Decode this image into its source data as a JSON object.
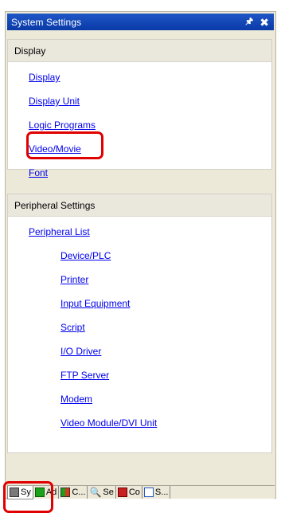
{
  "window": {
    "title": "System Settings"
  },
  "display_section": {
    "header": "Display",
    "items": [
      {
        "label": "Display"
      },
      {
        "label": "Display Unit"
      },
      {
        "label": "Logic Programs"
      },
      {
        "label": "Video/Movie"
      },
      {
        "label": "Font"
      }
    ]
  },
  "peripheral_section": {
    "header": "Peripheral Settings",
    "top_item": {
      "label": "Peripheral List"
    },
    "items": [
      {
        "label": "Device/PLC"
      },
      {
        "label": "Printer"
      },
      {
        "label": "Input Equipment"
      },
      {
        "label": "Script"
      },
      {
        "label": "I/O Driver"
      },
      {
        "label": "FTP Server"
      },
      {
        "label": "Modem"
      },
      {
        "label": "Video Module/DVI Unit"
      }
    ]
  },
  "tabs": [
    {
      "label": "Sy",
      "icon": "system-settings-icon"
    },
    {
      "label": "Ad",
      "icon": "address-icon"
    },
    {
      "label": "C...",
      "icon": "common-icon"
    },
    {
      "label": "Se",
      "icon": "search-icon"
    },
    {
      "label": "Co",
      "icon": "comment-icon"
    },
    {
      "label": "S...",
      "icon": "screen-icon"
    }
  ],
  "colors": {
    "title_bar": "#0a3aa8",
    "link": "#0000ee",
    "highlight": "#e00000"
  }
}
